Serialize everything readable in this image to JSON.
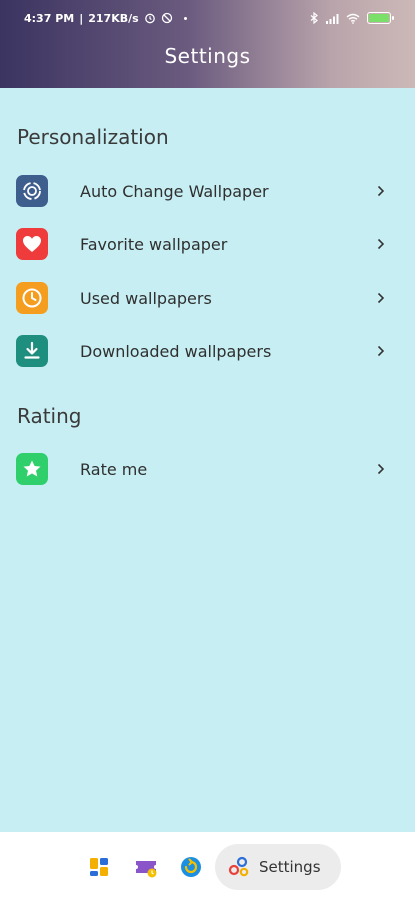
{
  "status_bar": {
    "time": "4:37 PM",
    "network_speed": "217KB/s",
    "battery_color": "#7be06a"
  },
  "app_bar": {
    "title": "Settings"
  },
  "sections": [
    {
      "header": "Personalization",
      "items": [
        {
          "label": "Auto Change Wallpaper",
          "icon": "auto-change-icon",
          "color": "#3e5f8e"
        },
        {
          "label": "Favorite wallpaper",
          "icon": "heart-icon",
          "color": "#ef3b3b"
        },
        {
          "label": "Used wallpapers",
          "icon": "clock-icon",
          "color": "#f59d1f"
        },
        {
          "label": "Downloaded wallpapers",
          "icon": "download-icon",
          "color": "#1e8f7f"
        }
      ]
    },
    {
      "header": "Rating",
      "items": [
        {
          "label": "Rate me",
          "icon": "star-icon",
          "color": "#2fcf6b"
        }
      ]
    }
  ],
  "bottom_nav": {
    "items": [
      {
        "icon": "grid-icon"
      },
      {
        "icon": "ticket-icon"
      },
      {
        "icon": "refresh-icon"
      },
      {
        "icon": "settings-icon",
        "label": "Settings",
        "active": true
      }
    ]
  }
}
